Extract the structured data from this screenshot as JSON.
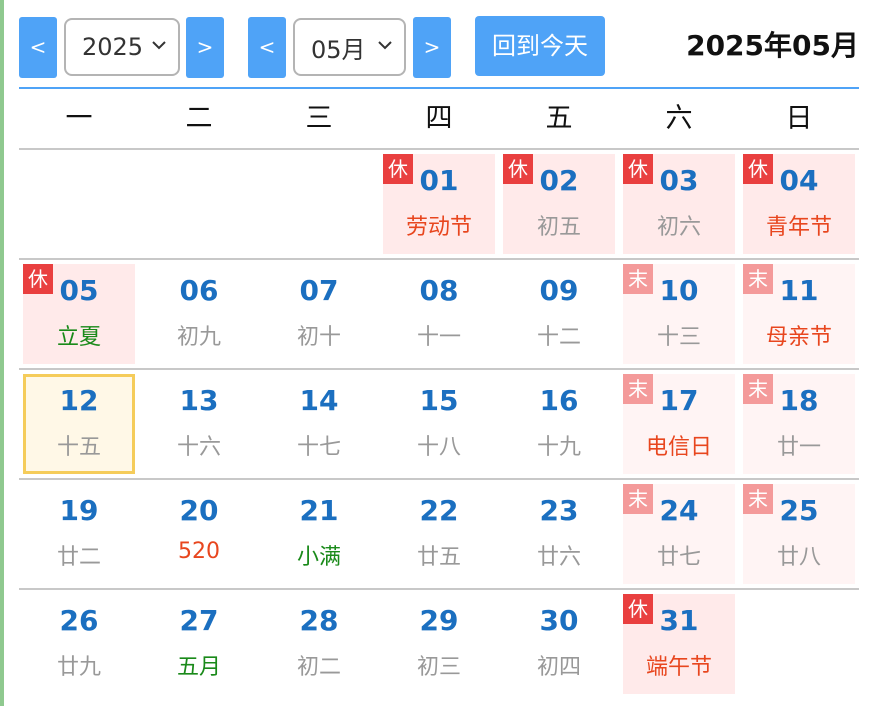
{
  "toolbar": {
    "prev_year": "<",
    "year_value": "2025",
    "next_year": ">",
    "prev_month": "<",
    "month_value": "05月",
    "next_month": ">",
    "today_button": "回到今天",
    "title": "2025年05月"
  },
  "weekdays": [
    "一",
    "二",
    "三",
    "四",
    "五",
    "六",
    "日"
  ],
  "badge_labels": {
    "holiday": "休",
    "weekend": "末"
  },
  "weeks": [
    [
      null,
      null,
      null,
      {
        "day": "01",
        "sub": "劳动节",
        "subtype": "red",
        "badge": "休",
        "bg": "holi"
      },
      {
        "day": "02",
        "sub": "初五",
        "subtype": "gray",
        "badge": "休",
        "bg": "holi"
      },
      {
        "day": "03",
        "sub": "初六",
        "subtype": "gray",
        "badge": "休",
        "bg": "holi"
      },
      {
        "day": "04",
        "sub": "青年节",
        "subtype": "red",
        "badge": "休",
        "bg": "holi"
      }
    ],
    [
      {
        "day": "05",
        "sub": "立夏",
        "subtype": "green",
        "badge": "休",
        "bg": "holi"
      },
      {
        "day": "06",
        "sub": "初九",
        "subtype": "gray",
        "badge": "",
        "bg": ""
      },
      {
        "day": "07",
        "sub": "初十",
        "subtype": "gray",
        "badge": "",
        "bg": ""
      },
      {
        "day": "08",
        "sub": "十一",
        "subtype": "gray",
        "badge": "",
        "bg": ""
      },
      {
        "day": "09",
        "sub": "十二",
        "subtype": "gray",
        "badge": "",
        "bg": ""
      },
      {
        "day": "10",
        "sub": "十三",
        "subtype": "gray",
        "badge": "末",
        "bg": "off"
      },
      {
        "day": "11",
        "sub": "母亲节",
        "subtype": "red",
        "badge": "末",
        "bg": "off"
      }
    ],
    [
      {
        "day": "12",
        "sub": "十五",
        "subtype": "gray",
        "badge": "",
        "bg": "today"
      },
      {
        "day": "13",
        "sub": "十六",
        "subtype": "gray",
        "badge": "",
        "bg": ""
      },
      {
        "day": "14",
        "sub": "十七",
        "subtype": "gray",
        "badge": "",
        "bg": ""
      },
      {
        "day": "15",
        "sub": "十八",
        "subtype": "gray",
        "badge": "",
        "bg": ""
      },
      {
        "day": "16",
        "sub": "十九",
        "subtype": "gray",
        "badge": "",
        "bg": ""
      },
      {
        "day": "17",
        "sub": "电信日",
        "subtype": "red",
        "badge": "末",
        "bg": "off"
      },
      {
        "day": "18",
        "sub": "廿一",
        "subtype": "gray",
        "badge": "末",
        "bg": "off"
      }
    ],
    [
      {
        "day": "19",
        "sub": "廿二",
        "subtype": "gray",
        "badge": "",
        "bg": ""
      },
      {
        "day": "20",
        "sub": "520",
        "subtype": "red",
        "badge": "",
        "bg": ""
      },
      {
        "day": "21",
        "sub": "小满",
        "subtype": "green",
        "badge": "",
        "bg": ""
      },
      {
        "day": "22",
        "sub": "廿五",
        "subtype": "gray",
        "badge": "",
        "bg": ""
      },
      {
        "day": "23",
        "sub": "廿六",
        "subtype": "gray",
        "badge": "",
        "bg": ""
      },
      {
        "day": "24",
        "sub": "廿七",
        "subtype": "gray",
        "badge": "末",
        "bg": "off"
      },
      {
        "day": "25",
        "sub": "廿八",
        "subtype": "gray",
        "badge": "末",
        "bg": "off"
      }
    ],
    [
      {
        "day": "26",
        "sub": "廿九",
        "subtype": "gray",
        "badge": "",
        "bg": ""
      },
      {
        "day": "27",
        "sub": "五月",
        "subtype": "green",
        "badge": "",
        "bg": ""
      },
      {
        "day": "28",
        "sub": "初二",
        "subtype": "gray",
        "badge": "",
        "bg": ""
      },
      {
        "day": "29",
        "sub": "初三",
        "subtype": "gray",
        "badge": "",
        "bg": ""
      },
      {
        "day": "30",
        "sub": "初四",
        "subtype": "gray",
        "badge": "",
        "bg": ""
      },
      {
        "day": "31",
        "sub": "端午节",
        "subtype": "red",
        "badge": "休",
        "bg": "holi"
      },
      null
    ]
  ],
  "colors": {
    "accent": "#4fa3f7",
    "day_number": "#1b6fc0",
    "holiday_badge": "#e93f3f",
    "weekend_badge": "#f49a9a",
    "today_border": "#f5cc5a"
  }
}
